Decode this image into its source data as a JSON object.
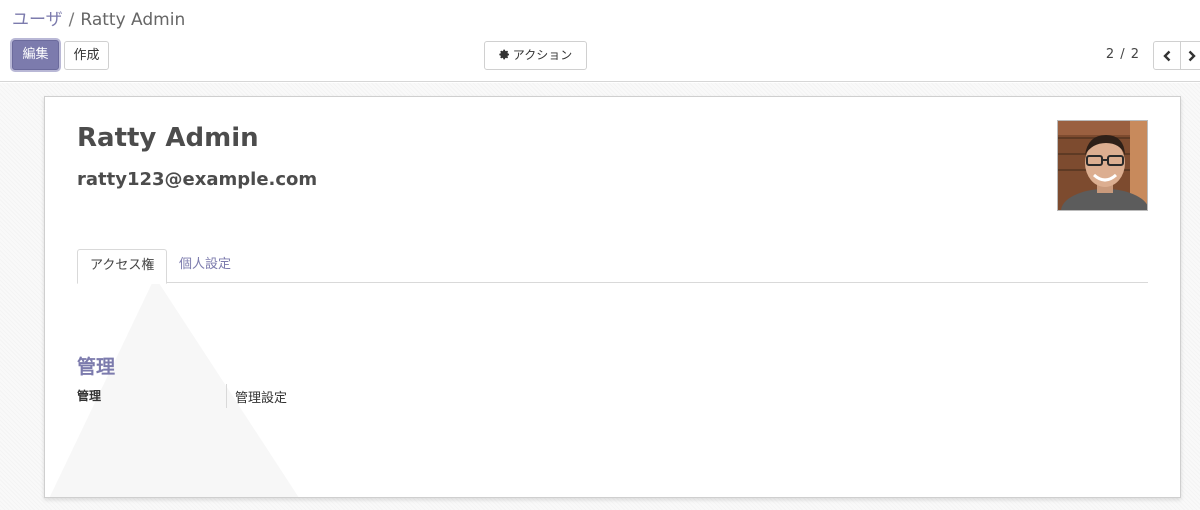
{
  "breadcrumb": {
    "parent": "ユーザ",
    "separator": "/",
    "current": "Ratty Admin"
  },
  "toolbar": {
    "edit_label": "編集",
    "create_label": "作成",
    "action_label": "アクション",
    "action_icon": "gear-icon"
  },
  "pager": {
    "value": "2 / 2",
    "prev_icon": "chevron-left-icon",
    "next_icon": "chevron-right-icon"
  },
  "record": {
    "name": "Ratty Admin",
    "login": "ratty123@example.com",
    "avatar": "user-photo"
  },
  "tabs": [
    {
      "label": "アクセス権",
      "active": true
    },
    {
      "label": "個人設定",
      "active": false
    }
  ],
  "access_rights": {
    "section_title": "管理",
    "fields": [
      {
        "label": "管理",
        "value": "管理設定"
      }
    ]
  },
  "colors": {
    "brand": "#7c7bad",
    "text": "#4c4c4c"
  }
}
